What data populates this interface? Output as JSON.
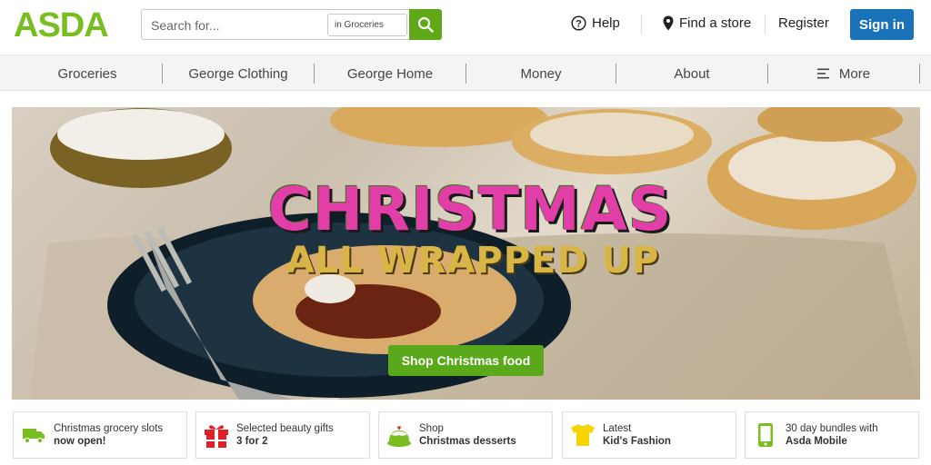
{
  "brand": {
    "logo_text": "ASDA",
    "accent": "#78be20",
    "button_green": "#5aa91b",
    "signin_blue": "#1a73b8"
  },
  "search": {
    "placeholder": "Search for...",
    "scope_label": "in Groceries",
    "icon": "search-icon"
  },
  "header": {
    "help_label": "Help",
    "store_label": "Find a store",
    "register_label": "Register",
    "signin_label": "Sign in"
  },
  "nav": {
    "items": [
      {
        "label": "Groceries"
      },
      {
        "label": "George Clothing"
      },
      {
        "label": "George Home"
      },
      {
        "label": "Money"
      },
      {
        "label": "About"
      },
      {
        "label": "More",
        "icon": "menu-icon"
      }
    ]
  },
  "hero": {
    "headline": "CHRISTMAS",
    "subline": "ALL WRAPPED UP",
    "cta_label": "Shop Christmas food"
  },
  "promos": [
    {
      "line1": "Christmas grocery slots",
      "line2": "now open!",
      "icon": "delivery-van-icon"
    },
    {
      "line1": "Selected beauty gifts",
      "line2": "3 for 2",
      "icon": "gift-icon"
    },
    {
      "line1": "Shop",
      "line2": "Christmas desserts",
      "icon": "dessert-icon"
    },
    {
      "line1": "Latest",
      "line2": "Kid's Fashion",
      "icon": "tshirt-icon"
    },
    {
      "line1": "30 day bundles with",
      "line2": "Asda Mobile",
      "icon": "mobile-phone-icon"
    }
  ]
}
